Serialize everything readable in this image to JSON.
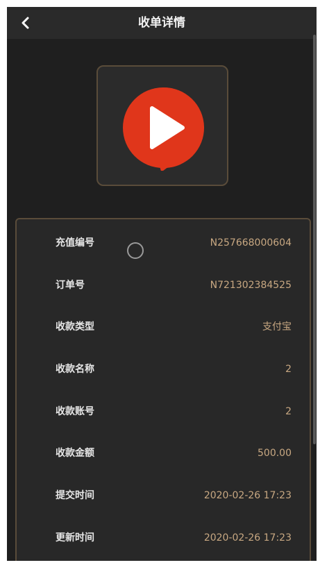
{
  "header": {
    "title": "收单详情"
  },
  "icons": {
    "back": "chevron-left-icon",
    "logo": "play-chat-logo-icon",
    "loading": "loading-ring-icon"
  },
  "colors": {
    "background": "#1f1f1f",
    "header": "#2a2a2a",
    "accent_border": "#5a4c3a",
    "value_text": "#c8a882",
    "logo_red": "#e0361b"
  },
  "details": [
    {
      "label": "充值编号",
      "value": "N257668000604"
    },
    {
      "label": "订单号",
      "value": "N721302384525"
    },
    {
      "label": "收款类型",
      "value": "支付宝"
    },
    {
      "label": "收款名称",
      "value": "2"
    },
    {
      "label": "收款账号",
      "value": "2"
    },
    {
      "label": "收款金额",
      "value": "500.00"
    },
    {
      "label": "提交时间",
      "value": "2020-02-26 17:23"
    },
    {
      "label": "更新时间",
      "value": "2020-02-26 17:23"
    }
  ]
}
